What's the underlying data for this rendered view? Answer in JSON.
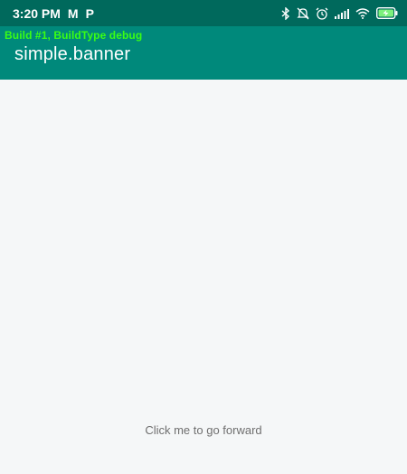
{
  "status_bar": {
    "time": "3:20 PM",
    "left_icons": [
      "M",
      "P"
    ],
    "right_icons": [
      "bluetooth-icon",
      "mute-icon",
      "alarm-icon",
      "signal-icon",
      "wifi-icon",
      "battery-charging-icon"
    ],
    "background": "#00695c"
  },
  "app_bar": {
    "build_label": "Build #1, BuildType debug",
    "title": "simple.banner",
    "background": "#00897b",
    "build_label_color": "#39ff14"
  },
  "main": {
    "forward_label": "Click me to go forward"
  }
}
